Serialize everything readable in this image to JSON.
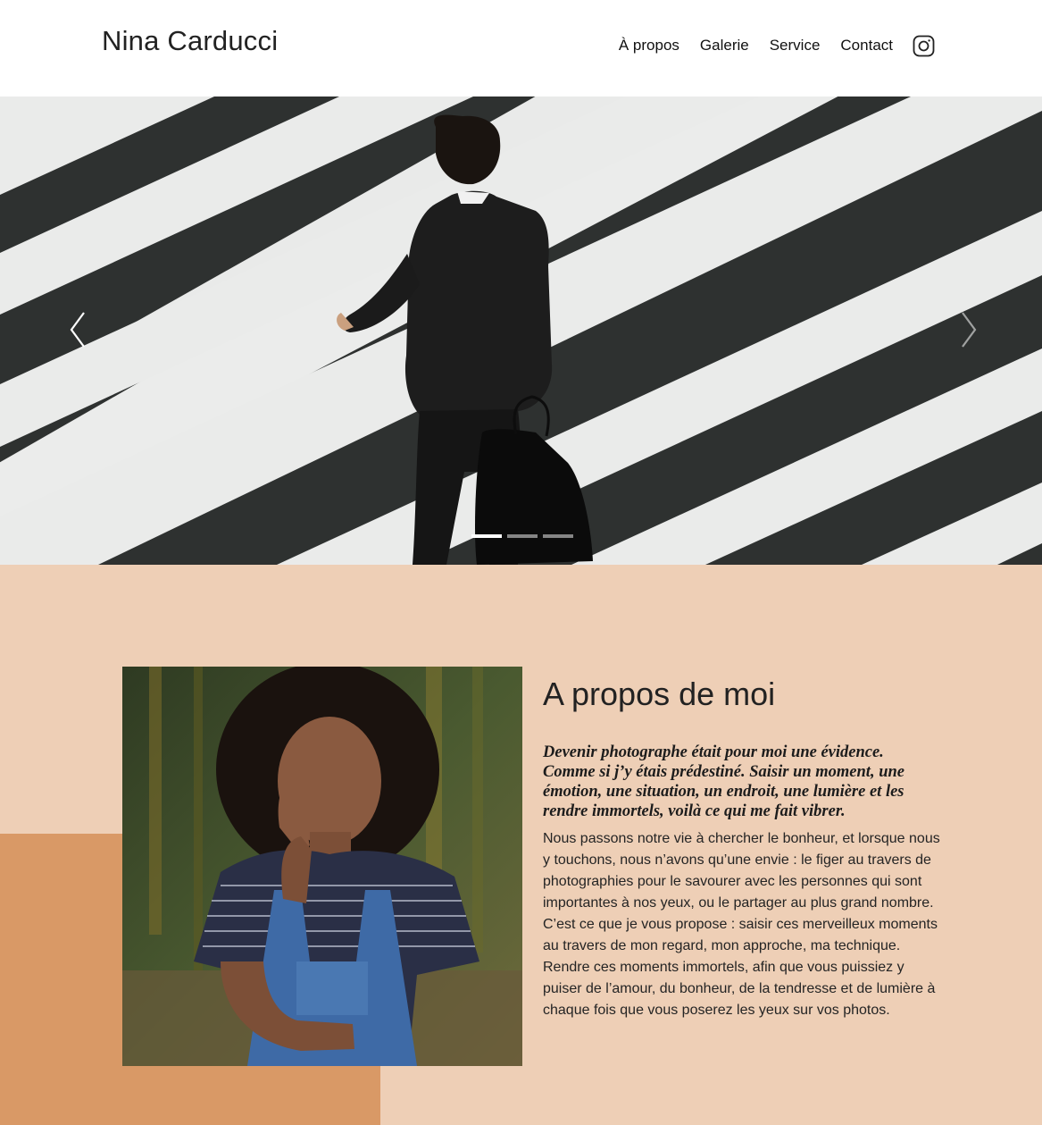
{
  "header": {
    "brand": "Nina Carducci",
    "nav": [
      {
        "label": "À propos"
      },
      {
        "label": "Galerie"
      },
      {
        "label": "Service"
      },
      {
        "label": "Contact"
      }
    ],
    "social_icon": "instagram-icon"
  },
  "carousel": {
    "prev_icon": "chevron-left-icon",
    "next_icon": "chevron-right-icon",
    "slide_count": 3,
    "active_index": 0
  },
  "about": {
    "title": "A propos de moi",
    "quote": "Devenir photographe était pour moi une évidence. Comme si j’y étais prédestiné. Saisir un moment, une émotion, une situation, un endroit, une lumière et les rendre immortels, voilà ce qui me fait vibrer.",
    "body": "Nous passons notre vie à chercher le bonheur, et lorsque nous y touchons, nous n’avons qu’une envie : le figer au travers de photographies pour le savourer avec les personnes qui sont importantes à nos yeux, ou le partager au plus grand nombre. C’est ce que je vous propose : saisir ces merveilleux moments au travers de mon regard, mon approche, ma technique. Rendre ces moments immortels, afin que vous puissiez y puiser de l’amour, du bonheur, de la tendresse et de lumière à chaque fois que vous poserez les yeux sur vos photos."
  },
  "colors": {
    "section_bg": "#eecfb6",
    "accent": "#d99966",
    "text": "#222222"
  }
}
